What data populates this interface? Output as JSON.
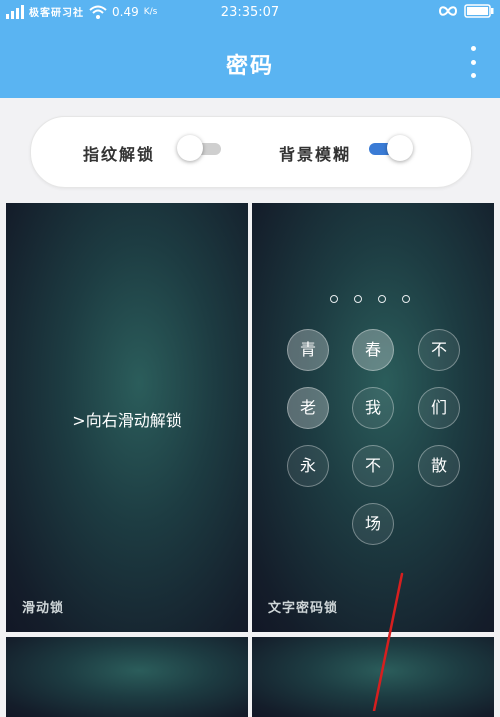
{
  "status_bar": {
    "carrier": "极客研习社",
    "speed": "0.49",
    "speed_unit": "K/s",
    "time": "23:35:07",
    "icons": [
      "signal-icon",
      "wifi-icon",
      "infinity-icon",
      "battery-icon"
    ]
  },
  "app_bar": {
    "title": "密码",
    "menu_icon": "more-vertical-icon"
  },
  "toggles": {
    "fingerprint": {
      "label": "指纹解锁",
      "enabled": false
    },
    "blur": {
      "label": "背景模糊",
      "enabled": true
    }
  },
  "lock_styles": [
    {
      "caption": "滑动锁",
      "hint": ">向右滑动解锁"
    },
    {
      "caption": "文字密码锁",
      "dot_count": 4,
      "chars": [
        [
          "青",
          "春",
          "不"
        ],
        [
          "老",
          "我",
          "们"
        ],
        [
          "永",
          "不",
          "散"
        ],
        [
          "场"
        ]
      ]
    }
  ],
  "colors": {
    "app_bar": "#5ab4f2",
    "switch_on": "#3a7bd5",
    "switch_off": "#cfcfcf",
    "annotation_line": "#d61f1f"
  }
}
